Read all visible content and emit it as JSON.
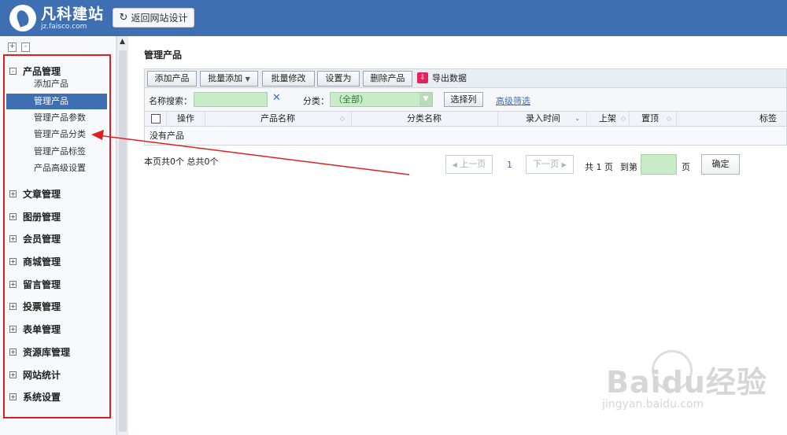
{
  "header": {
    "logo_name": "凡科建站",
    "logo_url": "jz.faisco.com",
    "back_button": "返回网站设计"
  },
  "sidebar": {
    "groups": [
      {
        "label": "产品管理",
        "expanded": true,
        "items": [
          "添加产品",
          "管理产品",
          "管理产品参数",
          "管理产品分类",
          "管理产品标签",
          "产品高级设置"
        ],
        "active": "管理产品"
      },
      {
        "label": "文章管理"
      },
      {
        "label": "图册管理"
      },
      {
        "label": "会员管理"
      },
      {
        "label": "商城管理"
      },
      {
        "label": "留言管理"
      },
      {
        "label": "投票管理"
      },
      {
        "label": "表单管理"
      },
      {
        "label": "资源库管理"
      },
      {
        "label": "网站统计"
      },
      {
        "label": "系统设置"
      }
    ]
  },
  "main": {
    "title": "管理产品",
    "toolbar": {
      "add": "添加产品",
      "batch_add": "批量添加",
      "batch_edit": "批量修改",
      "set_as": "设置为",
      "delete": "删除产品",
      "export": "导出数据"
    },
    "search": {
      "name_label": "名称搜索：",
      "name_value": "",
      "category_label": "分类：",
      "category_value": "（全部）",
      "choose_columns": "选择列",
      "advanced": "高级筛选"
    },
    "table": {
      "columns": [
        "操作",
        "产品名称",
        "分类名称",
        "录入时间",
        "上架",
        "置顶",
        "标签"
      ],
      "empty_text": "没有产品"
    },
    "summary": "本页共0个 总共0个",
    "pager": {
      "prev": "上一页",
      "current": "1",
      "next": "下一页",
      "total": "共 1 页",
      "goto": "到第",
      "page_unit": "页",
      "confirm": "确定"
    }
  },
  "watermark": {
    "brand": "Baidu经验",
    "url": "jingyan.baidu.com"
  },
  "colors": {
    "header_bg": "#3f6fb3",
    "active_item": "#3f6fb3",
    "annotation": "#e02020",
    "input_bg": "#c8ebc8"
  }
}
